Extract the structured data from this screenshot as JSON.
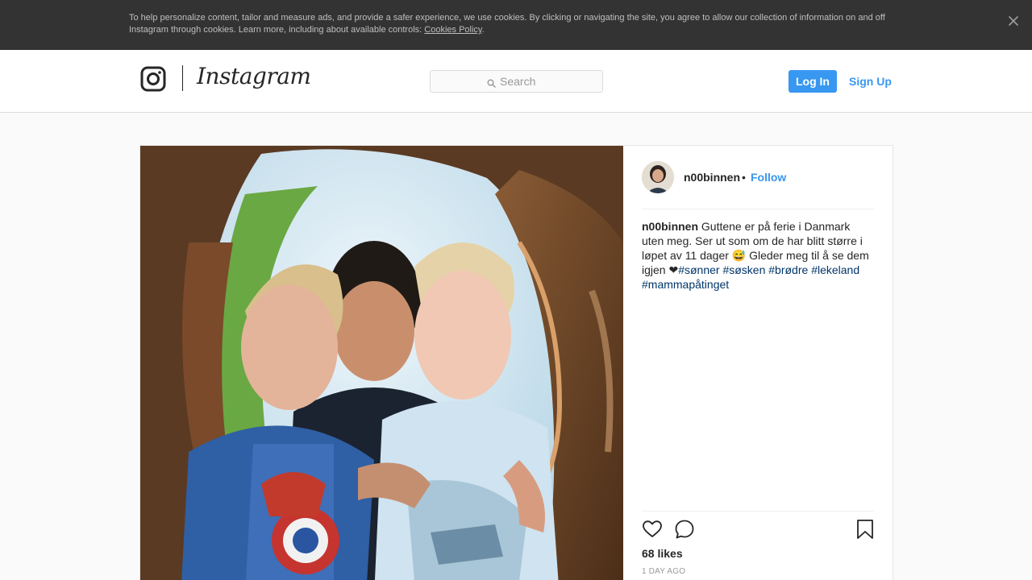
{
  "cookie_banner": {
    "text": "To help personalize content, tailor and measure ads, and provide a safer experience, we use cookies. By clicking or navigating the site, you agree to allow our collection of information on and off Instagram through cookies. Learn more, including about available controls: ",
    "policy_link": "Cookies Policy",
    "trailing": ".",
    "close_icon": "close-icon"
  },
  "header": {
    "logo_text": "Instagram",
    "logo_icon": "instagram-glyph-icon",
    "search_placeholder": "Search",
    "search_value": "",
    "login_label": "Log In",
    "signup_label": "Sign Up",
    "accent_color": "#3897f0"
  },
  "post": {
    "username": "n00binnen",
    "separator": "•",
    "follow_label": "Follow",
    "caption_user": "n00binnen",
    "caption_text": " Guttene er på ferie i Danmark uten meg. Ser ut som om de har blitt større i løpet av 11 dager 😅 Gleder meg til å se dem igjen ❤",
    "hashtags": [
      "#sønner",
      "#søsken",
      "#brødre",
      "#lekeland",
      "#mammapåtinget"
    ],
    "likes": "68 likes",
    "time_ago": "1 DAY AGO",
    "icons": [
      "heart-icon",
      "comment-icon",
      "bookmark-icon"
    ],
    "hashtag_color": "#003569"
  }
}
